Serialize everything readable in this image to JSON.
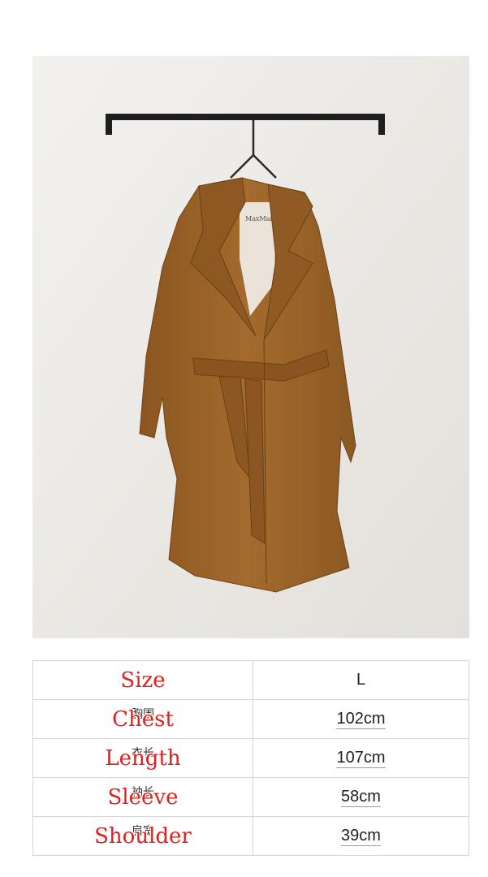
{
  "product_photo": {
    "hanger_tag": "MaxMara"
  },
  "size_table": {
    "rows": [
      {
        "cn": "",
        "en": "Size",
        "value": "L"
      },
      {
        "cn": "胸围",
        "en": "Chest",
        "value": "102cm"
      },
      {
        "cn": "衣长",
        "en": "Length",
        "value": "107cm"
      },
      {
        "cn": "袖长",
        "en": "Sleeve",
        "value": "58cm"
      },
      {
        "cn": "肩宽",
        "en": "Shoulder",
        "value": "39cm"
      }
    ]
  },
  "colors": {
    "label_red": "#e0201b",
    "coat_brown": "#9a6428",
    "border": "#d3d3d3"
  }
}
